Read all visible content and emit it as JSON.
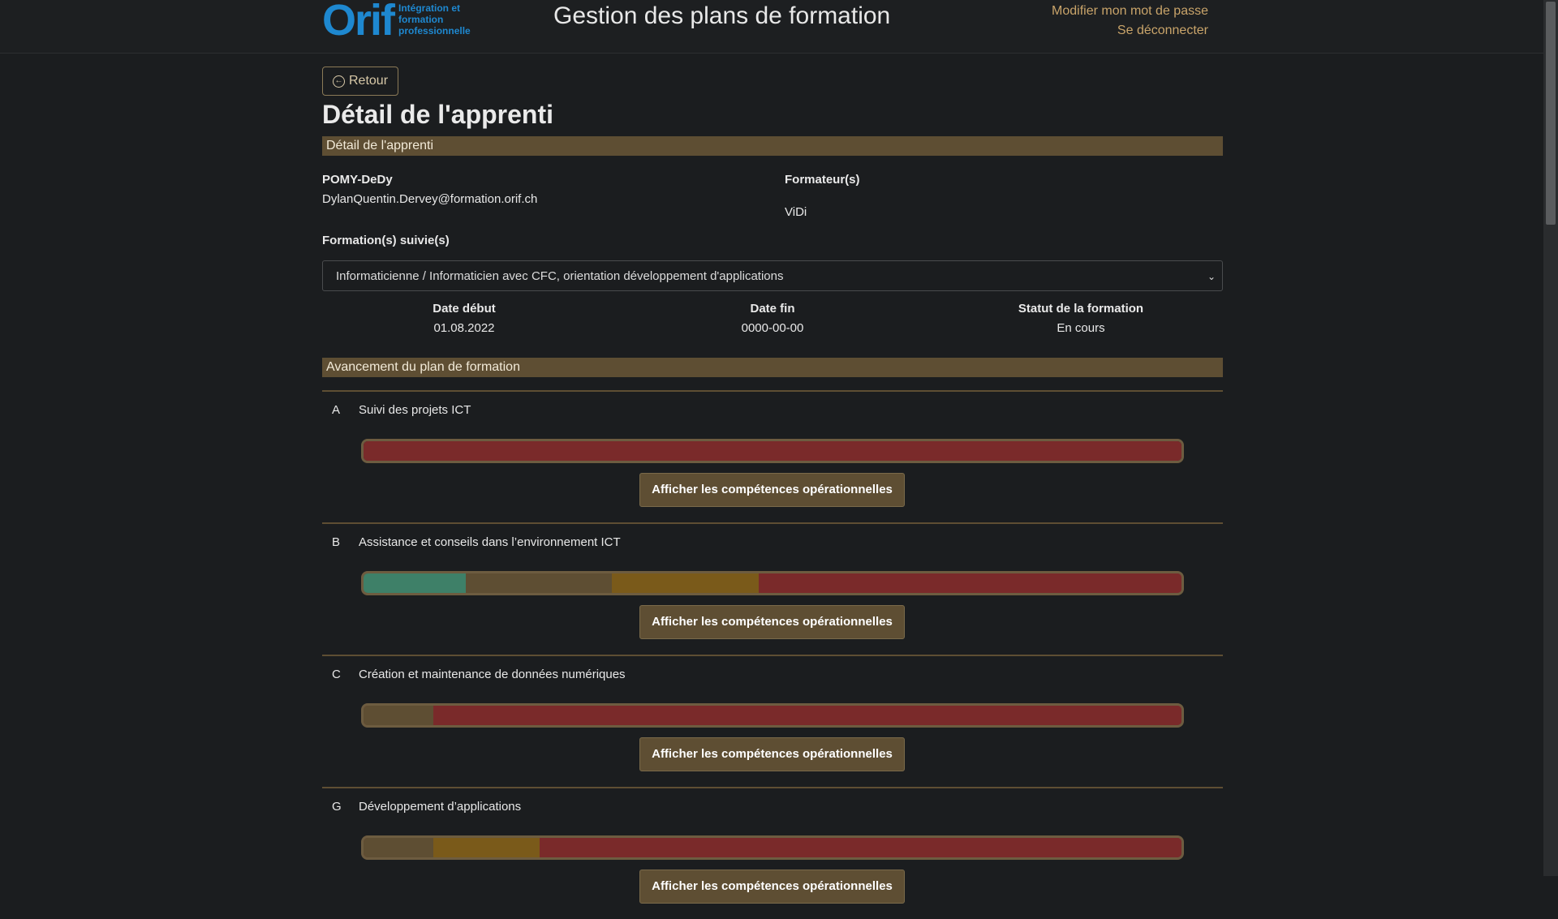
{
  "header": {
    "logo_text": "Orif",
    "logo_subtitle": "Intégration et formation professionnelle",
    "title": "Gestion des plans de formation",
    "change_password": "Modifier mon mot de passe",
    "logout": "Se déconnecter"
  },
  "back_label": "Retour",
  "page_title": "Détail de l'apprenti",
  "detail_section": "Détail de l'apprenti",
  "apprentice": {
    "username": "POMY-DeDy",
    "email": "DylanQuentin.Dervey@formation.orif.ch"
  },
  "trainers_label": "Formateur(s)",
  "trainer_name": "ViDi",
  "formations_label": "Formation(s) suivie(s)",
  "selected_formation": "Informaticienne / Informaticien avec CFC, orientation développement d'applications",
  "dates": {
    "start_label": "Date début",
    "start_value": "01.08.2022",
    "end_label": "Date fin",
    "end_value": "0000-00-00",
    "status_label": "Statut de la formation",
    "status_value": "En cours"
  },
  "progress_section": "Avancement du plan de formation",
  "colors": {
    "acquired": "#3e8068",
    "in_progress": "#5e4e33",
    "partial": "#7a5a1a",
    "not_acquired": "#7a2a2a"
  },
  "domains": [
    {
      "letter": "A",
      "name": "Suivi des projets ICT",
      "segments": [
        0,
        0,
        0,
        1.0
      ],
      "button": "Afficher les compétences opérationnelles"
    },
    {
      "letter": "B",
      "name": "Assistance et conseils dans l’environnement ICT",
      "segments": [
        0.125,
        0.179,
        0.179,
        0.517
      ],
      "button": "Afficher les compétences opérationnelles"
    },
    {
      "letter": "C",
      "name": "Création et maintenance de données numériques",
      "segments": [
        0,
        0.085,
        0,
        0.915
      ],
      "button": "Afficher les compétences opérationnelles"
    },
    {
      "letter": "G",
      "name": "Développement d’applications",
      "segments": [
        0,
        0.085,
        0.13,
        0.785
      ],
      "button": "Afficher les compétences opérationnelles"
    }
  ]
}
